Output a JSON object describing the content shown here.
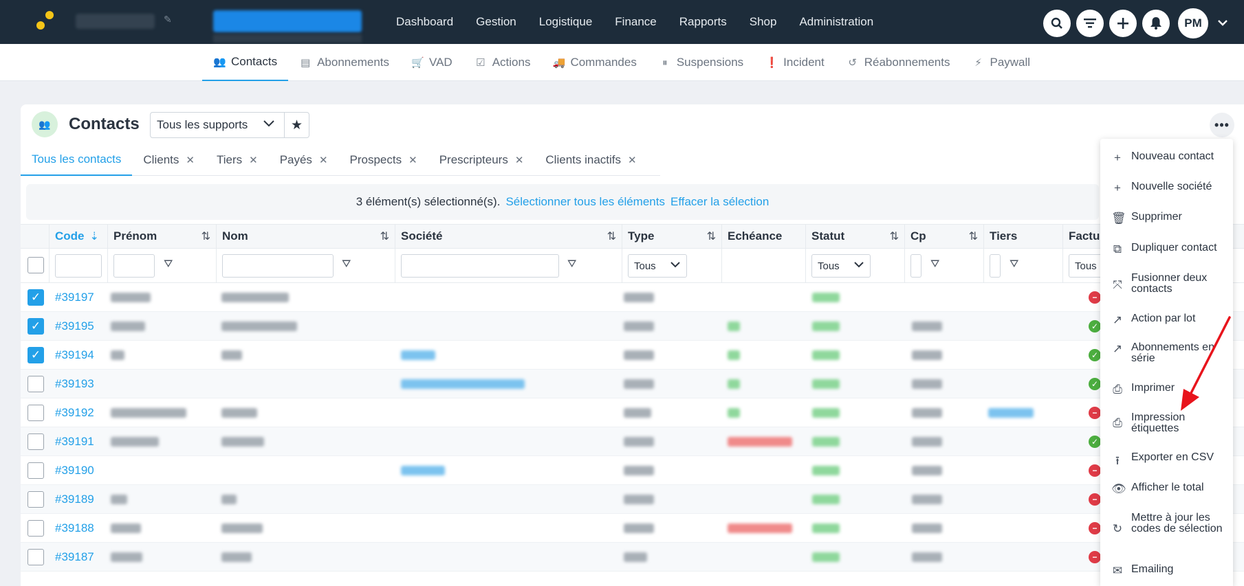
{
  "topbar": {
    "nav": [
      "Dashboard",
      "Gestion",
      "Logistique",
      "Finance",
      "Rapports",
      "Shop",
      "Administration"
    ],
    "avatar": "PM",
    "icons": [
      "search-icon",
      "filter-icon",
      "plus-icon",
      "bell-icon"
    ]
  },
  "subnav": [
    {
      "label": "Contacts",
      "icon": "users-icon",
      "active": true
    },
    {
      "label": "Abonnements",
      "icon": "stack-icon"
    },
    {
      "label": "VAD",
      "icon": "cart-icon"
    },
    {
      "label": "Actions",
      "icon": "check-square-icon"
    },
    {
      "label": "Commandes",
      "icon": "truck-icon"
    },
    {
      "label": "Suspensions",
      "icon": "pause-icon"
    },
    {
      "label": "Incident",
      "icon": "alert-icon"
    },
    {
      "label": "Réabonnements",
      "icon": "history-icon"
    },
    {
      "label": "Paywall",
      "icon": "bolt-icon"
    }
  ],
  "card": {
    "title": "Contacts",
    "support_select": "Tous les supports"
  },
  "filter_tabs": [
    {
      "label": "Tous les contacts",
      "active": true
    },
    {
      "label": "Clients"
    },
    {
      "label": "Tiers"
    },
    {
      "label": "Payés"
    },
    {
      "label": "Prospects"
    },
    {
      "label": "Prescripteurs"
    },
    {
      "label": "Clients inactifs"
    }
  ],
  "selection": {
    "text": "3 élément(s) sélectionné(s).",
    "select_all": "Sélectionner tous les éléments",
    "clear": "Effacer la sélection"
  },
  "table": {
    "headers": [
      "Code",
      "Prénom",
      "Nom",
      "Société",
      "Type",
      "Echéance",
      "Statut",
      "Cp",
      "Tiers",
      "Factur"
    ],
    "filter_select_default": "Tous",
    "rows": [
      {
        "code": "#39197",
        "checked": true,
        "status": "bad"
      },
      {
        "code": "#39195",
        "checked": true,
        "status": "ok"
      },
      {
        "code": "#39194",
        "checked": true,
        "status": "ok"
      },
      {
        "code": "#39193",
        "checked": false,
        "status": "ok"
      },
      {
        "code": "#39192",
        "checked": false,
        "status": "bad"
      },
      {
        "code": "#39191",
        "checked": false,
        "status": "ok"
      },
      {
        "code": "#39190",
        "checked": false,
        "status": "bad"
      },
      {
        "code": "#39189",
        "checked": false,
        "status": "bad"
      },
      {
        "code": "#39188",
        "checked": false,
        "status": "bad"
      },
      {
        "code": "#39187",
        "checked": false,
        "status": "bad"
      }
    ]
  },
  "menu": [
    {
      "label": "Nouveau contact",
      "icon": "plus-icon"
    },
    {
      "label": "Nouvelle société",
      "icon": "plus-icon"
    },
    {
      "label": "Supprimer",
      "icon": "trash-icon"
    },
    {
      "label": "Dupliquer contact",
      "icon": "copy-icon"
    },
    {
      "label": "Fusionner deux contacts",
      "icon": "merge-icon"
    },
    {
      "label": "Action par lot",
      "icon": "arrow-up-right-icon"
    },
    {
      "label": "Abonnements en série",
      "icon": "arrow-up-right-icon"
    },
    {
      "label": "Imprimer",
      "icon": "printer-icon"
    },
    {
      "label": "Impression étiquettes",
      "icon": "printer-icon"
    },
    {
      "label": "Exporter en CSV",
      "icon": "upload-icon"
    },
    {
      "label": "Afficher le total",
      "icon": "eye-icon"
    },
    {
      "label": "Mettre à jour les codes de sélection",
      "icon": "refresh-icon"
    },
    {
      "label": "Emailing",
      "icon": "mail-icon"
    }
  ],
  "colors": {
    "topbar": "#1d2c3a",
    "accent": "#23a0e8",
    "status_ok": "#4cae3f",
    "status_bad": "#e03b47",
    "arrow": "#e8141c"
  }
}
